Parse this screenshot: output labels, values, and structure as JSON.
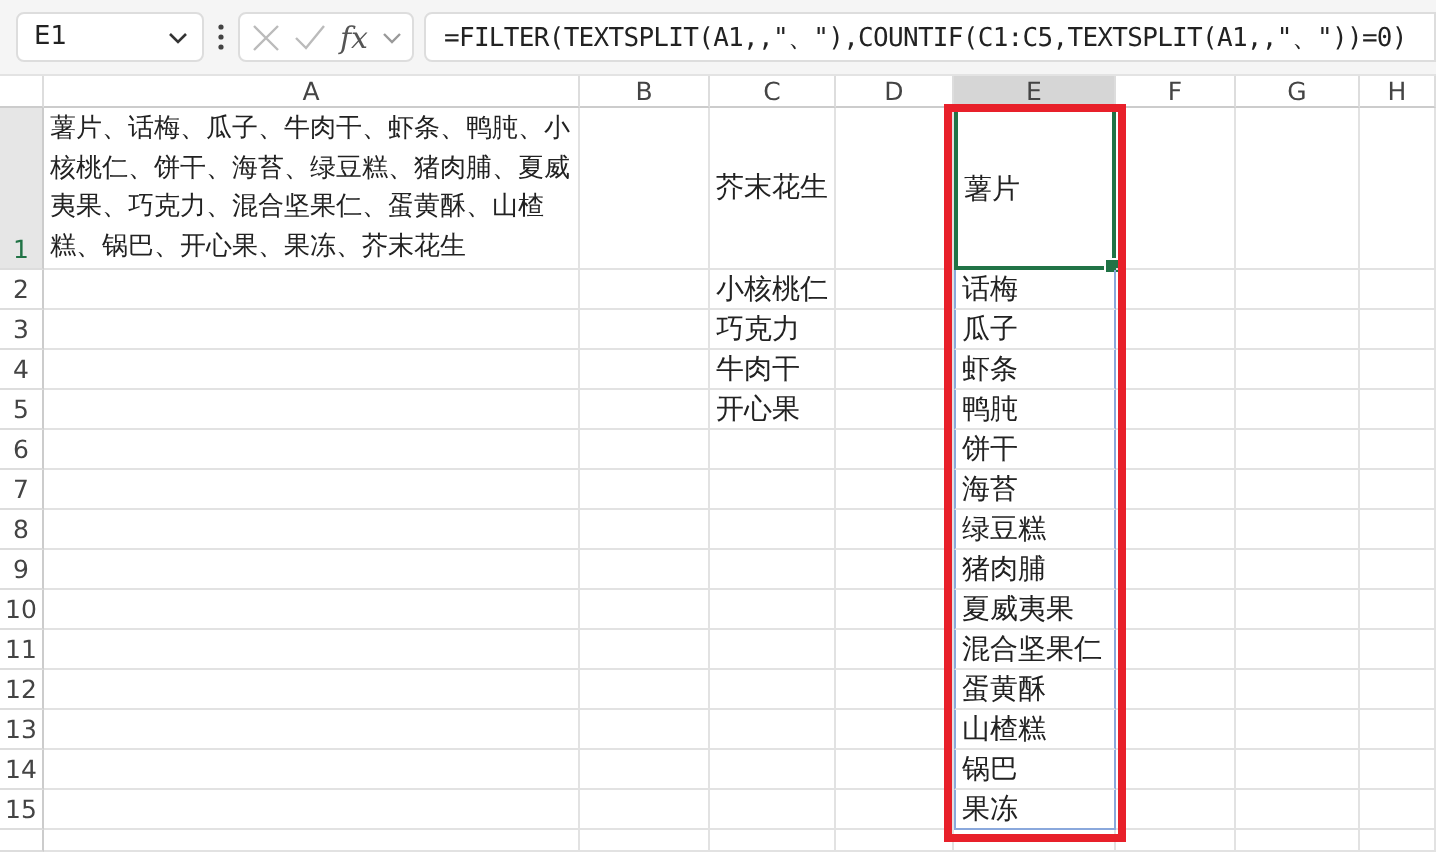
{
  "formula_bar": {
    "name_box": "E1",
    "fx": "fx",
    "formula": "=FILTER(TEXTSPLIT(A1,,\"、\"),COUNTIF(C1:C5,TEXTSPLIT(A1,,\"、\"))=0)"
  },
  "columns": [
    {
      "label": "A",
      "selected": false,
      "highlighted": false
    },
    {
      "label": "B",
      "selected": false,
      "highlighted": false
    },
    {
      "label": "C",
      "selected": false,
      "highlighted": false
    },
    {
      "label": "D",
      "selected": false,
      "highlighted": false
    },
    {
      "label": "E",
      "selected": true,
      "highlighted": true
    },
    {
      "label": "F",
      "selected": false,
      "highlighted": false
    },
    {
      "label": "G",
      "selected": false,
      "highlighted": false
    },
    {
      "label": "H",
      "selected": false,
      "highlighted": false
    }
  ],
  "rows": [
    {
      "number": "1",
      "selected": true,
      "a": "薯片、话梅、瓜子、牛肉干、虾条、鸭肫、小核桃仁、饼干、海苔、绿豆糕、猪肉脯、夏威夷果、巧克力、混合坚果仁、蛋黄酥、山楂糕、锅巴、开心果、果冻、芥末花生",
      "c": "芥末花生",
      "e": "薯片"
    },
    {
      "number": "2",
      "selected": false,
      "c": "小核桃仁",
      "e": "话梅"
    },
    {
      "number": "3",
      "selected": false,
      "c": "巧克力",
      "e": "瓜子"
    },
    {
      "number": "4",
      "selected": false,
      "c": "牛肉干",
      "e": "虾条"
    },
    {
      "number": "5",
      "selected": false,
      "c": "开心果",
      "e": "鸭肫"
    },
    {
      "number": "6",
      "selected": false,
      "e": "饼干"
    },
    {
      "number": "7",
      "selected": false,
      "e": "海苔"
    },
    {
      "number": "8",
      "selected": false,
      "e": "绿豆糕"
    },
    {
      "number": "9",
      "selected": false,
      "e": "猪肉脯"
    },
    {
      "number": "10",
      "selected": false,
      "e": "夏威夷果"
    },
    {
      "number": "11",
      "selected": false,
      "e": "混合坚果仁"
    },
    {
      "number": "12",
      "selected": false,
      "e": "蛋黄酥"
    },
    {
      "number": "13",
      "selected": false,
      "e": "山楂糕"
    },
    {
      "number": "14",
      "selected": false,
      "e": "锅巴"
    },
    {
      "number": "15",
      "selected": false,
      "e": "果冻"
    }
  ]
}
